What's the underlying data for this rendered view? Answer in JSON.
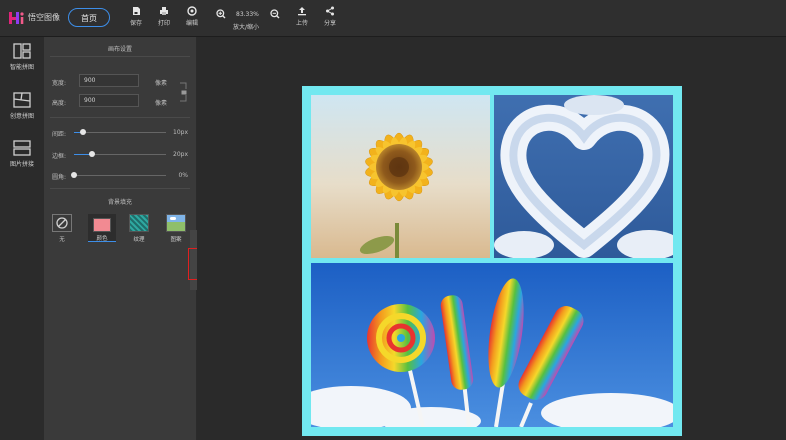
{
  "app": {
    "name": "悟空图像",
    "home_label": "首页"
  },
  "toolbar": {
    "save_label": "保存",
    "print_label": "打印",
    "edit_label": "编辑",
    "zoom_value": "83.33%",
    "zoom_label": "放大/缩小",
    "upload_label": "上传",
    "share_label": "分享"
  },
  "leftnav": {
    "items": [
      {
        "label": "智能拼图",
        "icon": "smart-collage-icon"
      },
      {
        "label": "创意拼图",
        "icon": "creative-collage-icon"
      },
      {
        "label": "图片拼接",
        "icon": "image-stitch-icon"
      }
    ]
  },
  "panel": {
    "title": "画布设置",
    "width_label": "宽度:",
    "width_value": "900",
    "height_label": "高度:",
    "height_value": "900",
    "unit_label": "像素",
    "spacing_label": "间距:",
    "spacing_value": "10px",
    "spacing_fraction": 0.1,
    "border_label": "边框:",
    "border_value": "20px",
    "border_fraction": 0.2,
    "radius_label": "圆角:",
    "radius_value": "0%",
    "radius_fraction": 0.0,
    "fill_title": "背景填充",
    "fill_options": [
      {
        "label": "无",
        "icon": "none-icon"
      },
      {
        "label": "颜色",
        "icon": "color-swatch-icon",
        "color": "#f28a92"
      },
      {
        "label": "纹理",
        "icon": "texture-icon"
      },
      {
        "label": "图案",
        "icon": "pattern-icon"
      }
    ]
  },
  "canvas": {
    "background_color": "#72e8f0"
  },
  "colors": {
    "accent": "#3d8ee8",
    "highlight": "#e02020"
  }
}
